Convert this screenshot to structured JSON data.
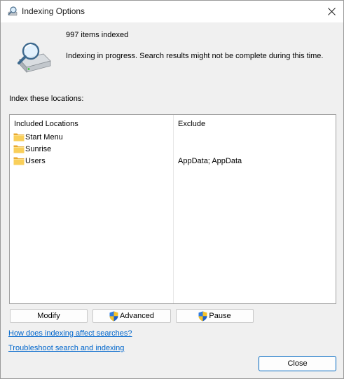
{
  "window": {
    "title": "Indexing Options"
  },
  "summary": {
    "items_indexed": "997 items indexed",
    "status": "Indexing in progress. Search results might not be complete during this time."
  },
  "locations": {
    "section_label": "Index these locations:",
    "columns": {
      "included": "Included Locations",
      "exclude": "Exclude"
    },
    "rows": [
      {
        "location": "Start Menu",
        "exclude": ""
      },
      {
        "location": "Sunrise",
        "exclude": ""
      },
      {
        "location": "Users",
        "exclude": "AppData; AppData"
      }
    ]
  },
  "buttons": {
    "modify": "Modify",
    "advanced": "Advanced",
    "pause": "Pause",
    "close": "Close"
  },
  "links": {
    "how_affects": "How does indexing affect searches?",
    "troubleshoot": "Troubleshoot search and indexing"
  },
  "icons": {
    "title": "indexing-options-icon",
    "main": "hard-drive-magnifier-icon",
    "folder": "folder-icon",
    "shield": "uac-shield-icon",
    "close": "close-icon"
  },
  "colors": {
    "link": "#0066cc",
    "close_button_border": "#0067c0",
    "folder": "#f5c342"
  }
}
